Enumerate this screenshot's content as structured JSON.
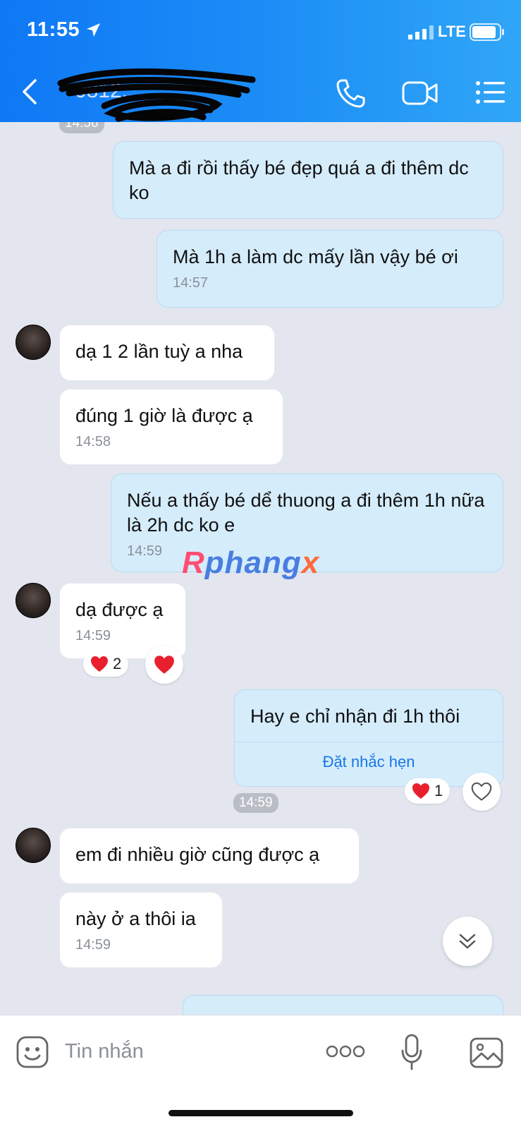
{
  "status_bar": {
    "time": "11:55",
    "network": "LTE",
    "icons": [
      "location-icon",
      "signal-icon",
      "battery-icon"
    ]
  },
  "header": {
    "contact_name": "0812...",
    "icons": [
      "back-icon",
      "call-icon",
      "video-call-icon",
      "menu-icon"
    ]
  },
  "messages": [
    {
      "type": "time",
      "time": "14:56"
    },
    {
      "type": "out",
      "text": "Mà a đi rồi thấy bé đẹp quá a đi thêm dc ko"
    },
    {
      "type": "out",
      "text": "Mà 1h a làm dc mấy lần vậy bé ơi",
      "time": "14:57"
    },
    {
      "type": "in",
      "text": "dạ 1 2 lần tuỳ a nha"
    },
    {
      "type": "in",
      "text": "đúng 1 giờ là được ạ",
      "time": "14:58"
    },
    {
      "type": "out",
      "text": "Nếu a thấy bé dể thuong a đi thêm 1h nữa là 2h dc ko e",
      "time": "14:59"
    },
    {
      "type": "in",
      "text": "dạ được ạ",
      "time": "14:59",
      "reaction_count": "2"
    },
    {
      "type": "out",
      "text": "Hay e chỉ nhận đi 1h thôi",
      "action": "Đặt nhắc hẹn",
      "reaction_count": "1"
    },
    {
      "type": "time",
      "time": "14:59"
    },
    {
      "type": "in",
      "text": "em đi nhiều giờ cũng được ạ"
    },
    {
      "type": "in",
      "text": "này ở a thôi ia",
      "time": "14:59"
    }
  ],
  "watermark": {
    "r": "R",
    "mid": "phang",
    "x": "x"
  },
  "input_bar": {
    "placeholder": "Tin nhắn",
    "icons": [
      "sticker-icon",
      "more-icon",
      "mic-icon",
      "image-icon"
    ]
  },
  "colors": {
    "header": "#1a88f5",
    "outgoing_bubble": "#d5ecfb",
    "incoming_bubble": "#ffffff",
    "chat_bg": "#e3e6ef",
    "link": "#1877e6",
    "heart": "#e8202e"
  }
}
